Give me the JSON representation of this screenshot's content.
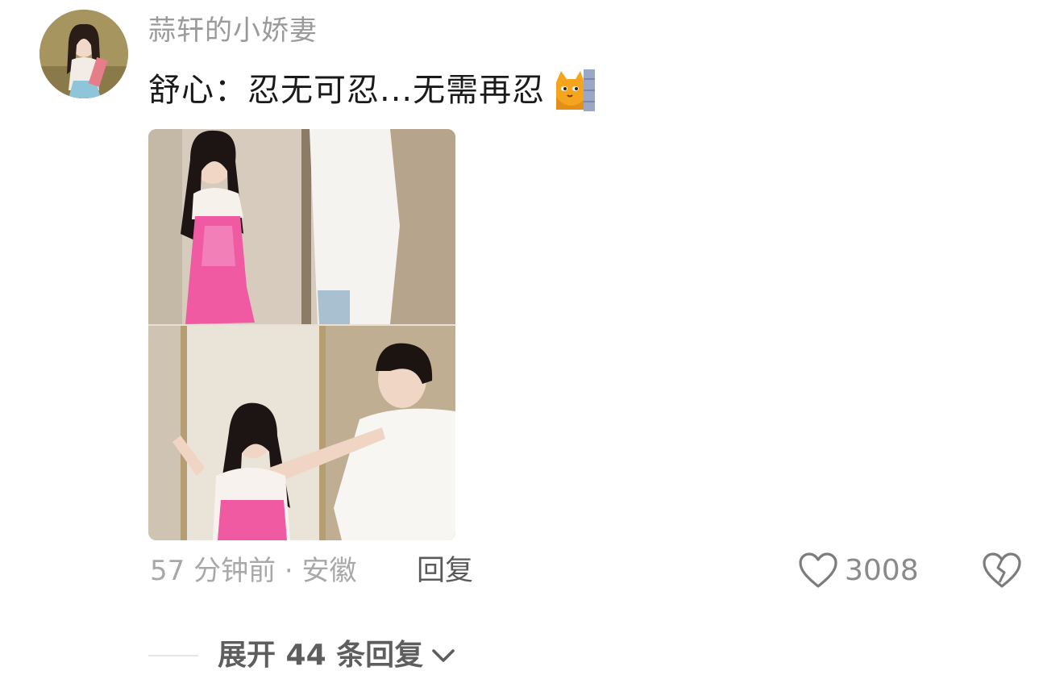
{
  "comment": {
    "username": "蒜轩的小娇妻",
    "text": "舒心：忍无可忍...无需再忍",
    "text_emoji": "cat-peeking-emoji",
    "meta": "57 分钟前 · 安徽",
    "reply_label": "回复",
    "like_count": "3008",
    "like_icon": "heart-outline-icon",
    "dislike_icon": "broken-heart-icon",
    "expand_label": "展开 44 条回复",
    "expand_icon": "chevron-down-icon"
  },
  "colors": {
    "username": "#9a9a9a",
    "text": "#1a1a1a",
    "meta": "#a8a8a8",
    "action": "#5a5a5a",
    "dress_pink": "#ef5aa3"
  }
}
